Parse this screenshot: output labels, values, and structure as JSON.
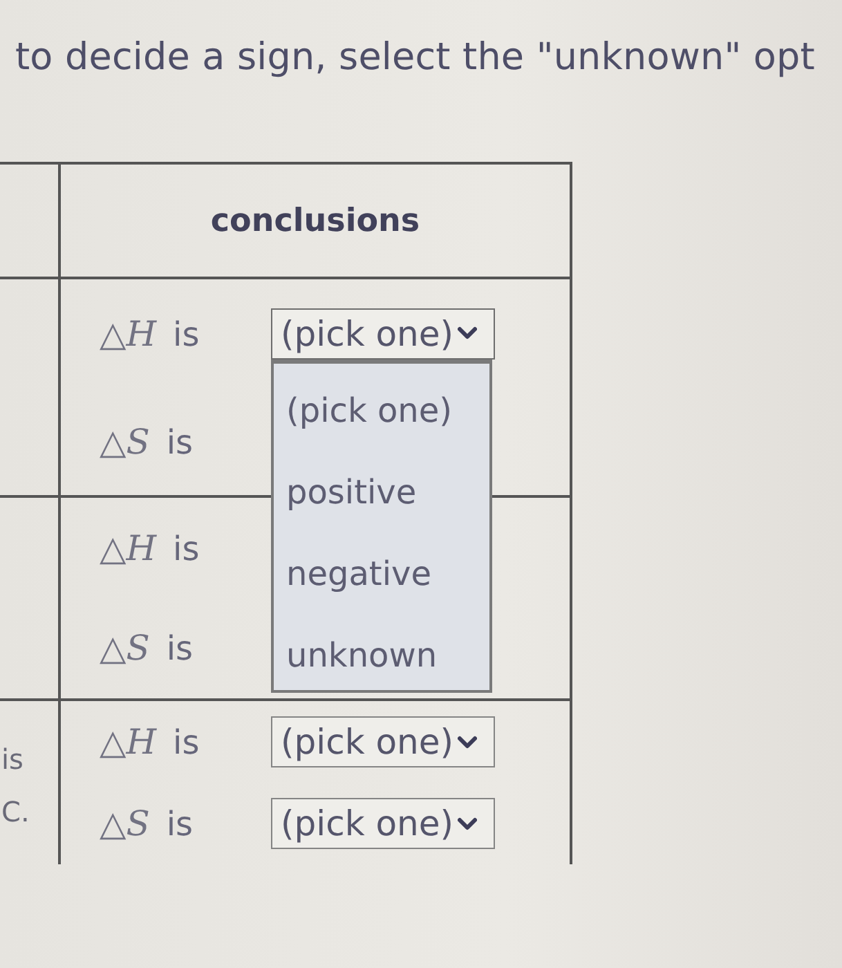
{
  "instruction": "to decide a sign, select the \"unknown\" opt",
  "table": {
    "heading": "conclusions",
    "rows": [
      {
        "conclusions": [
          {
            "quantity": "△*H*",
            "verb": "is",
            "dropdown": {
              "value": "(pick one)",
              "expanded": true,
              "options": [
                "(pick one)",
                "positive",
                "negative",
                "unknown"
              ]
            }
          },
          {
            "quantity": "△*S*",
            "verb": "is"
          }
        ]
      },
      {
        "conclusions": [
          {
            "quantity": "△*H*",
            "verb": "is"
          },
          {
            "quantity": "△*S*",
            "verb": "is"
          }
        ]
      },
      {
        "column_1": [
          "is",
          "C."
        ],
        "conclusions": [
          {
            "quantity": "△*H*",
            "verb": "is",
            "dropdown": {
              "value": "(pick one)"
            }
          },
          {
            "quantity": "△*S*",
            "verb": "is",
            "dropdown": {
              "value": "(pick one)"
            }
          }
        ]
      }
    ]
  }
}
